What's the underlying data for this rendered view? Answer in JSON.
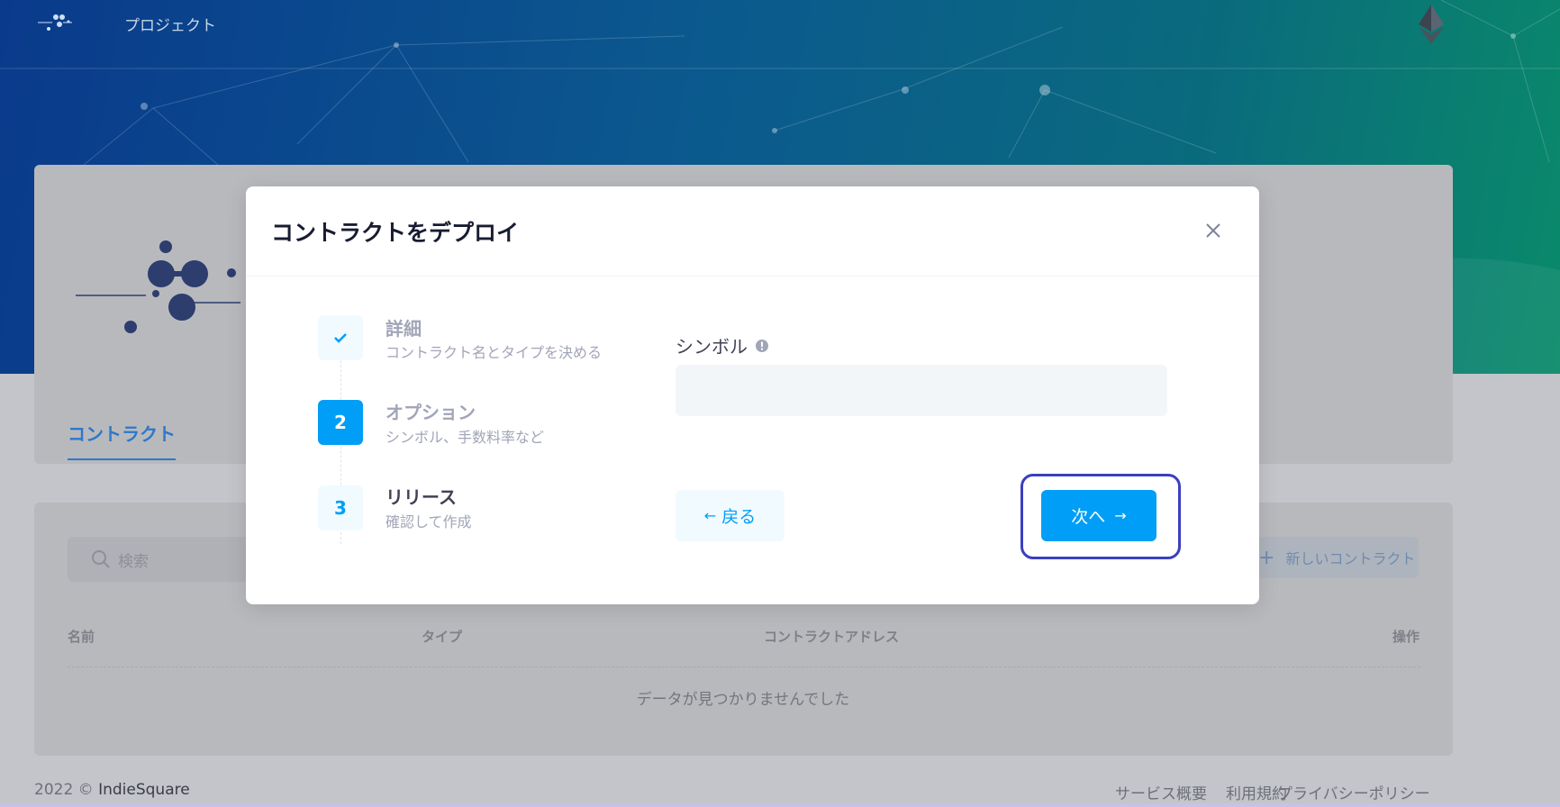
{
  "topbar": {
    "nav_label": "プロジェクト"
  },
  "page": {
    "tab_label": "コントラクト",
    "search_placeholder": "検索",
    "new_contract_label": "新しいコントラクト",
    "table": {
      "columns": [
        "名前",
        "タイプ",
        "コントラクトアドレス",
        "操作"
      ],
      "empty_message": "データが見つかりませんでした"
    }
  },
  "footer": {
    "copyright": "2022 ©",
    "company": "IndieSquare",
    "links": [
      "サービス概要",
      "利用規約",
      "プライバシーポリシー"
    ]
  },
  "modal": {
    "title": "コントラクトをデプロイ",
    "steps": [
      {
        "number": "✓",
        "title": "詳細",
        "subtitle": "コントラクト名とタイプを決める",
        "state": "completed"
      },
      {
        "number": "2",
        "title": "オプション",
        "subtitle": "シンボル、手数料率など",
        "state": "current"
      },
      {
        "number": "3",
        "title": "リリース",
        "subtitle": "確認して作成",
        "state": "pending"
      }
    ],
    "field": {
      "label": "シンボル",
      "value": ""
    },
    "back_label": "戻る",
    "next_label": "次へ"
  },
  "colors": {
    "primary": "#009ef7",
    "primary_light": "#f1faff",
    "highlight": "#3a3fc0"
  },
  "icons": {
    "close": "close-icon",
    "info": "info-icon",
    "back_arrow": "arrow-left-icon",
    "next_arrow": "arrow-right-icon",
    "check": "check-icon",
    "search": "search-icon",
    "plus": "plus-icon",
    "ethereum": "ethereum-icon"
  }
}
